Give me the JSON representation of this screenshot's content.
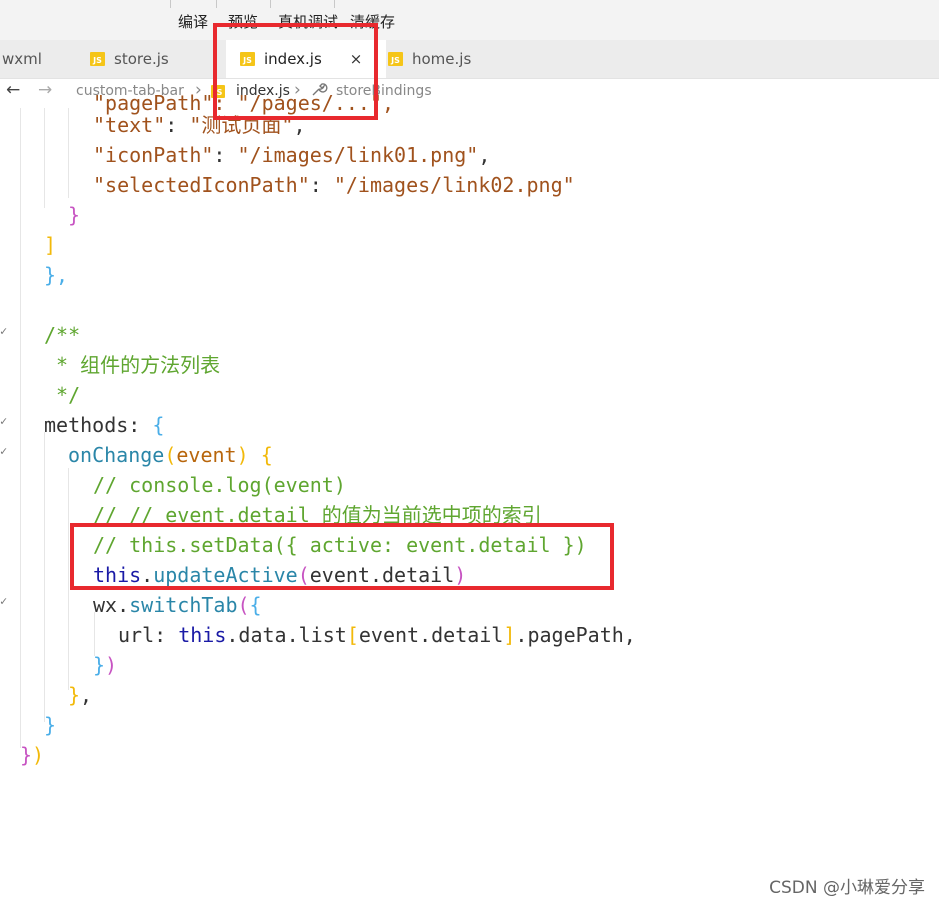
{
  "toolbar": {
    "compile": "编译",
    "preview": "预览",
    "real_debug": "真机调试",
    "clear_cache": "清缓存"
  },
  "tabs": [
    {
      "label": "wxml",
      "icon": "none"
    },
    {
      "label": "store.js",
      "icon": "js-icon"
    },
    {
      "label": "index.js",
      "icon": "js-icon",
      "active": true,
      "close": "×"
    },
    {
      "label": "home.js",
      "icon": "js-icon"
    }
  ],
  "breadcrumb": {
    "back": "←",
    "forward": "→",
    "folder": "custom-tab-bar",
    "file": "index.js",
    "symbol": "storeBindings",
    "sep": "›"
  },
  "code": {
    "l0": "\"pagePath\": \"/pages/...\",",
    "l1_key": "\"text\"",
    "l1_val": "\"测试页面\"",
    "l2_key": "\"iconPath\"",
    "l2_val": "\"/images/link01.png\"",
    "l3_key": "\"selectedIconPath\"",
    "l3_val": "\"/images/link02.png\"",
    "l4": "}",
    "l5": "]",
    "l6": "},",
    "l8": "/**",
    "l9": " * 组件的方法列表",
    "l10": " */",
    "l11_a": "methods",
    "l11_b": ": {",
    "l12_fn": "onChange",
    "l12_param": "event",
    "l13": "// console.log(event)",
    "l14": "// // event.detail 的值为当前选中项的索引",
    "l15": "// this.setData({ active: event.detail })",
    "l16_this": "this",
    "l16_fn": "updateActive",
    "l16_arg": "event.detail",
    "l17_obj": "wx.",
    "l17_fn": "switchTab",
    "l18_key": "url",
    "l18_this": "this",
    "l18_rest": ".data.list",
    "l18_idx": "event.detail",
    "l18_end": ".pagePath,",
    "l19": "})",
    "l20": "},",
    "l21": "}",
    "l22": "})"
  },
  "watermark": "CSDN @小琳爱分享",
  "colors": {
    "highlight": "#e8292e",
    "comment": "#5fa630",
    "string": "#a0521d",
    "keyword_this": "#1a1aa6",
    "function": "#2a86a8"
  }
}
